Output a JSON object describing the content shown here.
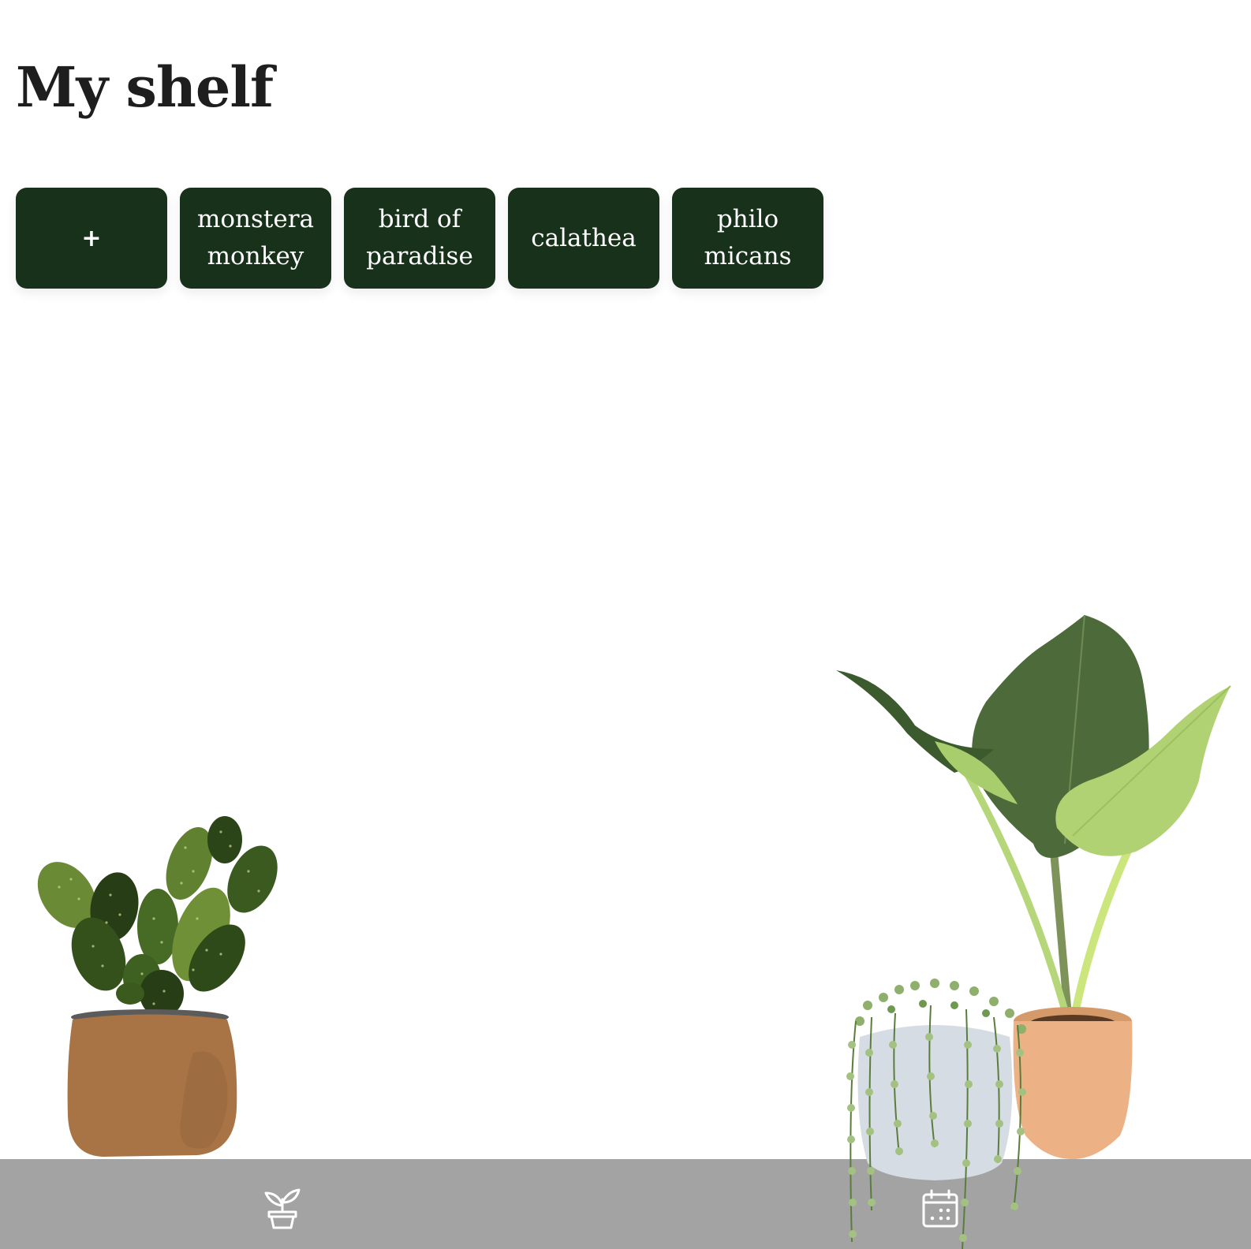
{
  "header": {
    "title": "My shelf"
  },
  "shelf": {
    "add_label": "+",
    "plants": [
      {
        "label": "monstera monkey"
      },
      {
        "label": "bird of paradise"
      },
      {
        "label": "calathea"
      },
      {
        "label": "philo micans"
      }
    ]
  },
  "bottom_nav": {
    "items": [
      {
        "icon": "plant-pot-icon"
      },
      {
        "icon": "calendar-icon"
      }
    ]
  },
  "colors": {
    "card_background": "#17311a",
    "card_text": "#ffffff",
    "title_text": "#1e1e1e",
    "nav_background": "#a3a3a3",
    "page_background": "#ffffff"
  }
}
